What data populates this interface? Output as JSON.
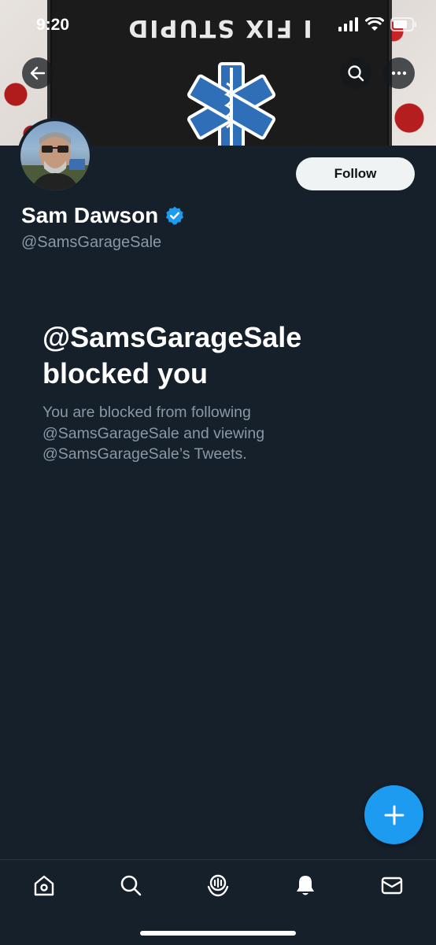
{
  "status_bar": {
    "time": "9:20"
  },
  "banner": {
    "patch_text": "I FIX STUPID"
  },
  "profile": {
    "display_name": "Sam Dawson",
    "handle": "@SamsGarageSale",
    "verified": true,
    "follow_label": "Follow"
  },
  "blocked": {
    "title_line1": "@SamsGarageSale",
    "title_line2": "blocked you",
    "body": "You are blocked from following @SamsGarageSale and viewing @SamsGarageSale’s Tweets."
  },
  "icons": {
    "back": "arrow-left-icon",
    "search": "search-icon",
    "more": "more-icon",
    "verified": "verified-badge-icon",
    "compose": "plus-icon",
    "nav": [
      "home-icon",
      "search-icon",
      "spaces-icon",
      "bell-icon",
      "mail-icon"
    ]
  },
  "colors": {
    "background": "#15202b",
    "accent": "#1d9bf0",
    "secondary_text": "#8b98a5",
    "follow_bg": "#eff3f4"
  }
}
